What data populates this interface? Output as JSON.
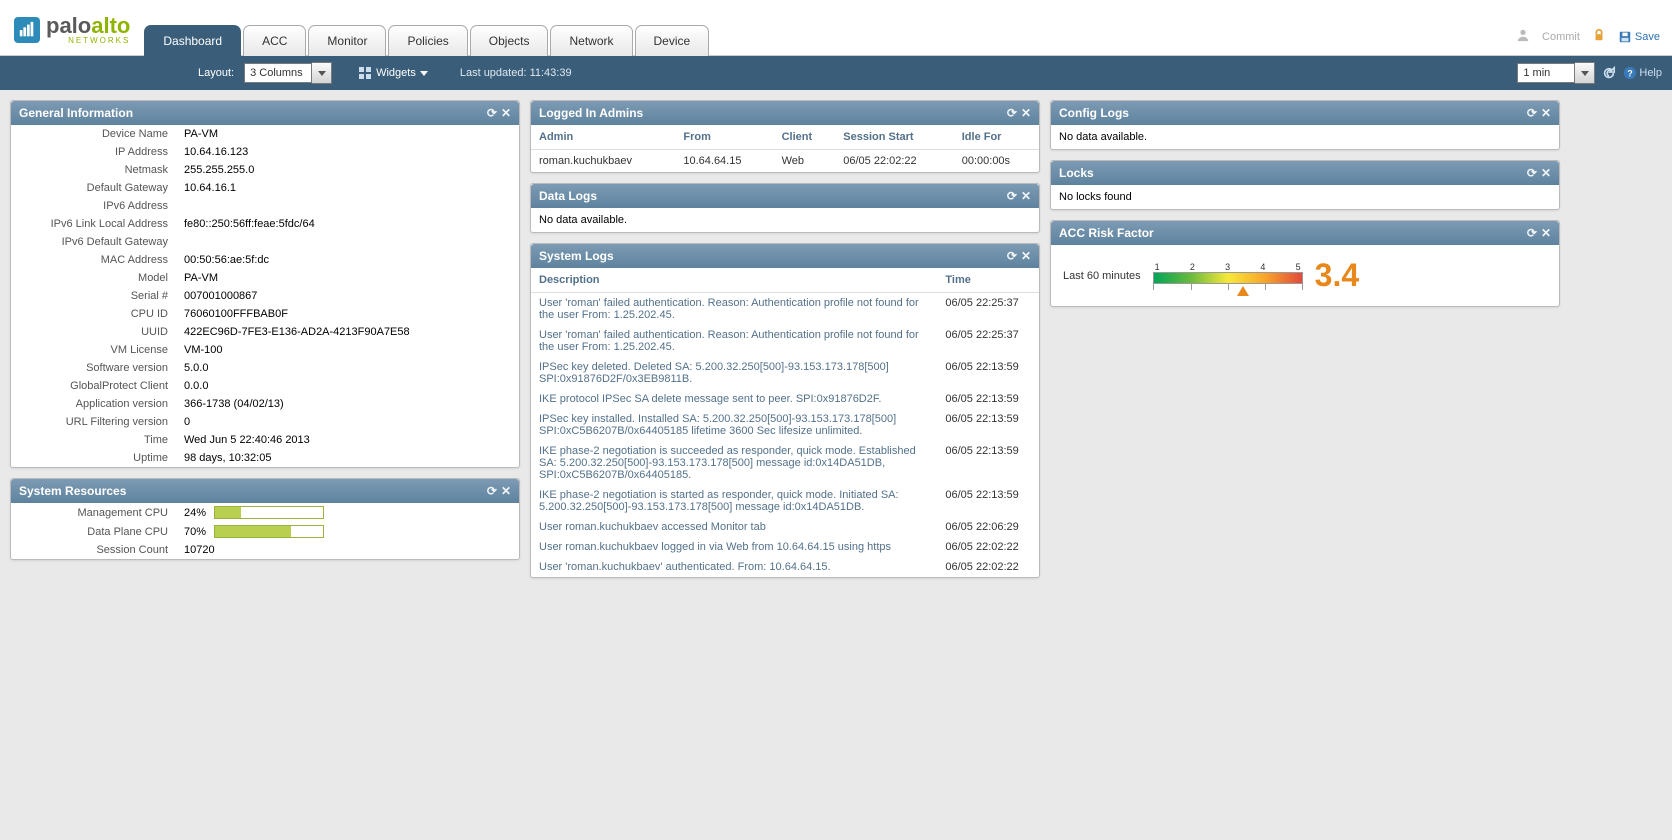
{
  "brand": {
    "palo": "palo",
    "alto": "alto",
    "net": "NETWORKS"
  },
  "tabs": [
    "Dashboard",
    "ACC",
    "Monitor",
    "Policies",
    "Objects",
    "Network",
    "Device"
  ],
  "active_tab": 0,
  "top_actions": {
    "commit": "Commit",
    "save": "Save"
  },
  "subbar": {
    "layout_label": "Layout:",
    "layout_value": "3 Columns",
    "widgets_label": "Widgets",
    "last_updated_label": "Last updated:",
    "last_updated_value": "11:43:39",
    "refresh_options": "1 min",
    "help": "Help"
  },
  "general_info": {
    "title": "General Information",
    "rows": [
      {
        "k": "Device Name",
        "v": "PA-VM"
      },
      {
        "k": "IP Address",
        "v": "10.64.16.123"
      },
      {
        "k": "Netmask",
        "v": "255.255.255.0"
      },
      {
        "k": "Default Gateway",
        "v": "10.64.16.1"
      },
      {
        "k": "IPv6 Address",
        "v": ""
      },
      {
        "k": "IPv6 Link Local Address",
        "v": "fe80::250:56ff:feae:5fdc/64"
      },
      {
        "k": "IPv6 Default Gateway",
        "v": ""
      },
      {
        "k": "MAC Address",
        "v": "00:50:56:ae:5f:dc"
      },
      {
        "k": "Model",
        "v": "PA-VM"
      },
      {
        "k": "Serial #",
        "v": "007001000867"
      },
      {
        "k": "CPU ID",
        "v": "76060100FFFBAB0F"
      },
      {
        "k": "UUID",
        "v": "422EC96D-7FE3-E136-AD2A-4213F90A7E58"
      },
      {
        "k": "VM License",
        "v": "VM-100"
      },
      {
        "k": "Software version",
        "v": "5.0.0"
      },
      {
        "k": "GlobalProtect Client",
        "v": "0.0.0"
      },
      {
        "k": "Application version",
        "v": "366-1738 (04/02/13)"
      },
      {
        "k": "URL Filtering version",
        "v": "0"
      },
      {
        "k": "Time",
        "v": "Wed Jun 5 22:40:46 2013"
      },
      {
        "k": "Uptime",
        "v": "98 days, 10:32:05"
      }
    ]
  },
  "system_resources": {
    "title": "System Resources",
    "rows": [
      {
        "k": "Management CPU",
        "pct": 24,
        "txt": "24%"
      },
      {
        "k": "Data Plane CPU",
        "pct": 70,
        "txt": "70%"
      },
      {
        "k": "Session Count",
        "pct": null,
        "txt": "10720"
      }
    ]
  },
  "logged_admins": {
    "title": "Logged In Admins",
    "cols": [
      "Admin",
      "From",
      "Client",
      "Session Start",
      "Idle For"
    ],
    "rows": [
      [
        "roman.kuchukbaev",
        "10.64.64.15",
        "Web",
        "06/05 22:02:22",
        "00:00:00s"
      ]
    ]
  },
  "data_logs": {
    "title": "Data Logs",
    "msg": "No data available."
  },
  "system_logs": {
    "title": "System Logs",
    "cols": [
      "Description",
      "Time"
    ],
    "rows": [
      [
        "User 'roman' failed authentication. Reason: Authentication profile not found for the user From: 1.25.202.45.",
        "06/05 22:25:37"
      ],
      [
        "User 'roman' failed authentication. Reason: Authentication profile not found for the user From: 1.25.202.45.",
        "06/05 22:25:37"
      ],
      [
        "IPSec key deleted. Deleted SA: 5.200.32.250[500]-93.153.173.178[500] SPI:0x91876D2F/0x3EB9811B.",
        "06/05 22:13:59"
      ],
      [
        "IKE protocol IPSec SA delete message sent to peer. SPI:0x91876D2F.",
        "06/05 22:13:59"
      ],
      [
        "IPSec key installed. Installed SA: 5.200.32.250[500]-93.153.173.178[500] SPI:0xC5B6207B/0x64405185 lifetime 3600 Sec lifesize unlimited.",
        "06/05 22:13:59"
      ],
      [
        "IKE phase-2 negotiation is succeeded as responder, quick mode. Established SA: 5.200.32.250[500]-93.153.173.178[500] message id:0x14DA51DB, SPI:0xC5B6207B/0x64405185.",
        "06/05 22:13:59"
      ],
      [
        "IKE phase-2 negotiation is started as responder, quick mode. Initiated SA: 5.200.32.250[500]-93.153.173.178[500] message id:0x14DA51DB.",
        "06/05 22:13:59"
      ],
      [
        "User roman.kuchukbaev accessed Monitor tab",
        "06/05 22:06:29"
      ],
      [
        "User roman.kuchukbaev logged in via Web from 10.64.64.15 using https",
        "06/05 22:02:22"
      ],
      [
        "User 'roman.kuchukbaev' authenticated. From: 10.64.64.15.",
        "06/05 22:02:22"
      ]
    ]
  },
  "config_logs": {
    "title": "Config Logs",
    "msg": "No data available."
  },
  "locks": {
    "title": "Locks",
    "msg": "No locks found"
  },
  "acc_risk": {
    "title": "ACC Risk Factor",
    "label": "Last 60 minutes",
    "scale": [
      "1",
      "2",
      "3",
      "4",
      "5"
    ],
    "value": "3.4",
    "pointer_pct": 60
  }
}
